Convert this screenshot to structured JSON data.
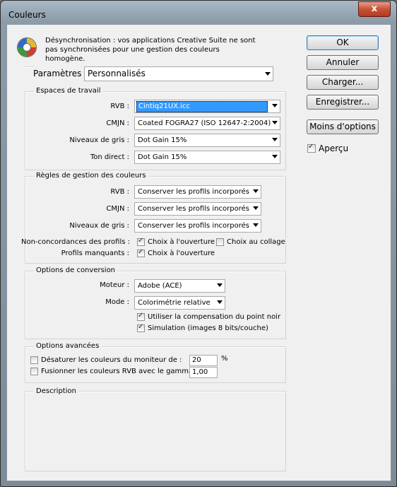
{
  "window": {
    "title": "Couleurs",
    "close_glyph": "x"
  },
  "sync_message": "Désynchronisation : vos applications Creative Suite ne sont pas synchronisées pour une gestion des couleurs homogène.",
  "settings": {
    "label": "Paramètres :",
    "value": "Personnalisés"
  },
  "workspaces": {
    "title": "Espaces de travail",
    "rvb_label": "RVB :",
    "rvb_value": "Cintiq21UX.icc",
    "cmjn_label": "CMJN :",
    "cmjn_value": "Coated FOGRA27 (ISO 12647-2:2004)",
    "gray_label": "Niveaux de gris :",
    "gray_value": "Dot Gain 15%",
    "spot_label": "Ton direct :",
    "spot_value": "Dot Gain 15%"
  },
  "policies": {
    "title": "Règles de gestion des couleurs",
    "rvb_label": "RVB :",
    "rvb_value": "Conserver les profils incorporés",
    "cmjn_label": "CMJN :",
    "cmjn_value": "Conserver les profils incorporés",
    "gray_label": "Niveaux de gris :",
    "gray_value": "Conserver les profils incorporés",
    "mismatch_label": "Non-concordances des profils :",
    "mismatch_open_label": "Choix à l'ouverture",
    "mismatch_open_checked": true,
    "mismatch_paste_label": "Choix au collage",
    "mismatch_paste_checked": false,
    "missing_label": "Profils manquants :",
    "missing_open_label": "Choix à l'ouverture",
    "missing_open_checked": true
  },
  "conversion": {
    "title": "Options de conversion",
    "engine_label": "Moteur :",
    "engine_value": "Adobe (ACE)",
    "mode_label": "Mode :",
    "mode_value": "Colorimétrie relative",
    "bpc_label": "Utiliser la compensation du point noir",
    "bpc_checked": true,
    "dither_label": "Simulation (images 8 bits/couche)",
    "dither_checked": true
  },
  "advanced": {
    "title": "Options avancées",
    "desaturate_label": "Désaturer les couleurs du moniteur de :",
    "desaturate_value": "20",
    "desaturate_unit": "%",
    "desaturate_checked": false,
    "blend_label": "Fusionner les couleurs RVB avec le gamma :",
    "blend_value": "1,00",
    "blend_checked": false
  },
  "description": {
    "title": "Description"
  },
  "buttons": {
    "ok": "OK",
    "cancel": "Annuler",
    "load": "Charger...",
    "save": "Enregistrer...",
    "fewer_options": "Moins d'options",
    "preview_label": "Aperçu",
    "preview_checked": true
  },
  "colors": {
    "accent": "#3399ff",
    "title_bar": "#aab9c6",
    "close": "#c95236"
  },
  "icons": {
    "sync": "color-sync-icon"
  }
}
